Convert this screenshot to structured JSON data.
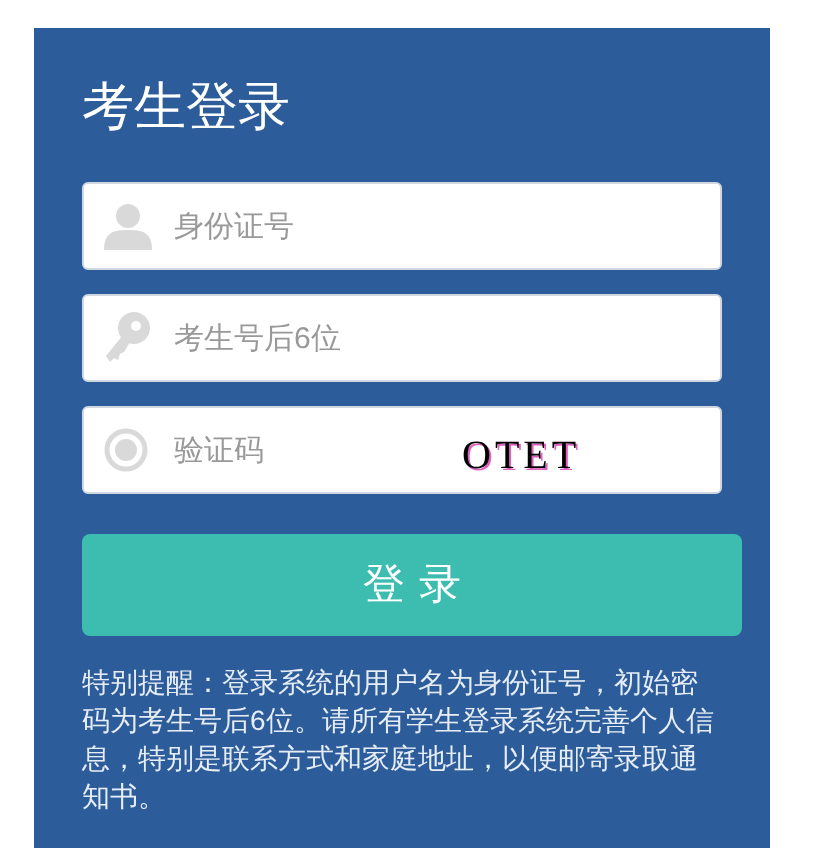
{
  "title": "考生登录",
  "fields": [
    {
      "kind": "id",
      "placeholder": "身份证号"
    },
    {
      "kind": "password",
      "placeholder": "考生号后6位"
    },
    {
      "kind": "captcha",
      "placeholder": "验证码",
      "captcha_text": "OTET"
    }
  ],
  "login_button": "登 录",
  "notice": "特别提醒：登录系统的用户名为身份证号，初始密码为考生号后6位。请所有学生登录系统完善个人信息，特别是联系方式和家庭地址，以便邮寄录取通知书。"
}
